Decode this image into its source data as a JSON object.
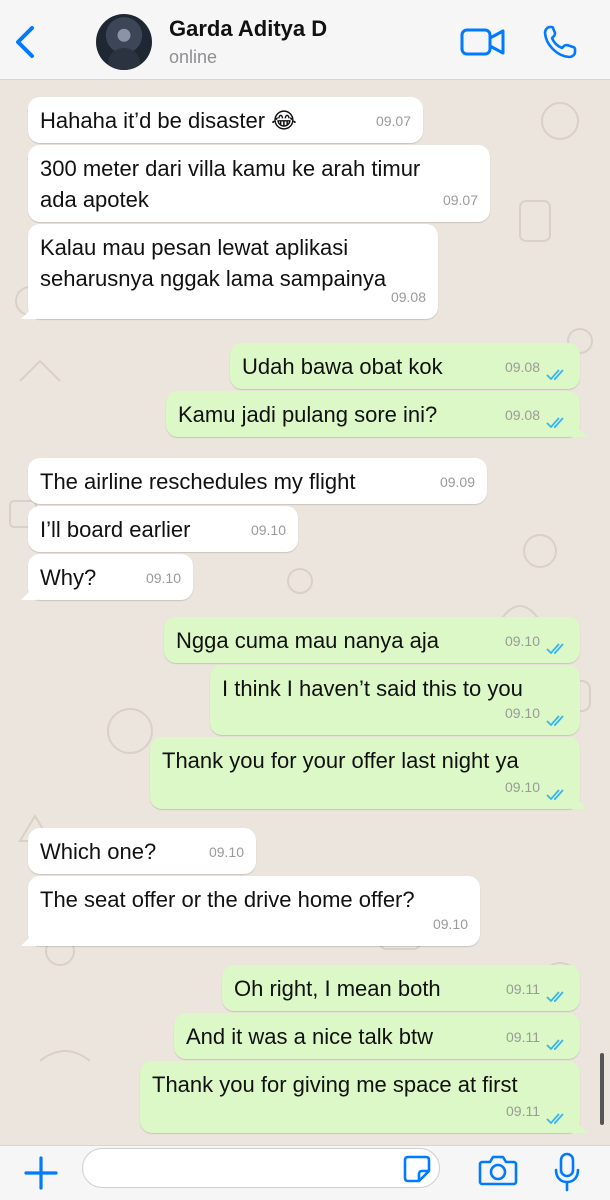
{
  "header": {
    "contact_name": "Garda Aditya D",
    "status": "online",
    "icons": {
      "back": "chevron-left-icon",
      "video": "video-camera-icon",
      "call": "phone-icon"
    },
    "accent_color": "#007aff"
  },
  "messages": [
    {
      "direction": "in",
      "text": "Hahaha it’d be disaster 😂",
      "time": "09.07"
    },
    {
      "direction": "in",
      "text": "300 meter dari villa kamu ke arah timur\nada apotek",
      "time": "09.07"
    },
    {
      "direction": "in",
      "text": "Kalau mau pesan lewat aplikasi\nseharusnya nggak lama sampainya",
      "time": "09.08"
    },
    {
      "direction": "out",
      "text": "Udah bawa obat kok",
      "time": "09.08",
      "read": true
    },
    {
      "direction": "out",
      "text": "Kamu jadi pulang sore ini?",
      "time": "09.08",
      "read": true
    },
    {
      "direction": "in",
      "text": "The airline reschedules my flight",
      "time": "09.09"
    },
    {
      "direction": "in",
      "text": "I’ll board earlier",
      "time": "09.10"
    },
    {
      "direction": "in",
      "text": "Why?",
      "time": "09.10"
    },
    {
      "direction": "out",
      "text": "Ngga cuma mau nanya aja",
      "time": "09.10",
      "read": true
    },
    {
      "direction": "out",
      "text": "I think I haven’t said this to you",
      "time": "09.10",
      "read": true
    },
    {
      "direction": "out",
      "text": "Thank you for your offer last night ya",
      "time": "09.10",
      "read": true
    },
    {
      "direction": "in",
      "text": "Which one?",
      "time": "09.10"
    },
    {
      "direction": "in",
      "text": "The seat offer or the drive home offer?",
      "time": "09.10"
    },
    {
      "direction": "out",
      "text": "Oh right, I mean both",
      "time": "09.11",
      "read": true
    },
    {
      "direction": "out",
      "text": "And it was a nice talk btw",
      "time": "09.11",
      "read": true
    },
    {
      "direction": "out",
      "text": "Thank you for giving me space at first",
      "time": "09.11",
      "read": true
    }
  ],
  "colors": {
    "incoming_bubble": "#ffffff",
    "outgoing_bubble": "#dcf8c6",
    "read_ticks": "#34b7f1",
    "wallpaper": "#ece5dd"
  },
  "footer": {
    "input_value": "",
    "icons": {
      "attach": "plus-icon",
      "sticker": "sticker-icon",
      "camera": "camera-icon",
      "mic": "microphone-icon"
    }
  }
}
